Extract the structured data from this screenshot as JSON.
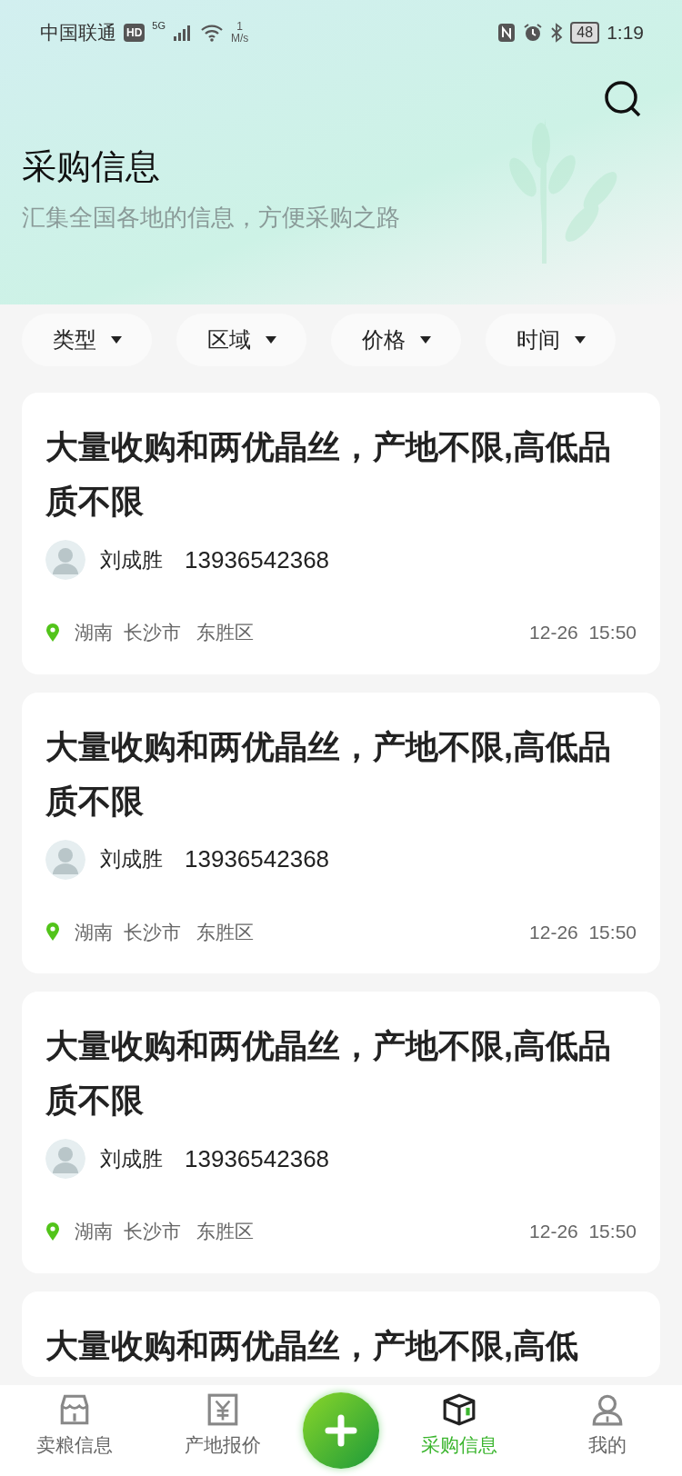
{
  "status_bar": {
    "carrier": "中国联通",
    "hd": "HD",
    "network": "5G",
    "speed_value": "1",
    "speed_unit": "M/s",
    "battery": "48",
    "time": "1:19"
  },
  "header": {
    "title": "采购信息",
    "subtitle": "汇集全国各地的信息，方便采购之路"
  },
  "filters": [
    "类型",
    "区域",
    "价格",
    "时间"
  ],
  "cards": [
    {
      "title": "大量收购和两优晶丝，产地不限,高低品质不限",
      "name": "刘成胜",
      "phone": "13936542368",
      "province": "湖南",
      "city": "长沙市",
      "district": "东胜区",
      "date": "12-26",
      "time": "15:50"
    },
    {
      "title": "大量收购和两优晶丝，产地不限,高低品质不限",
      "name": "刘成胜",
      "phone": "13936542368",
      "province": "湖南",
      "city": "长沙市",
      "district": "东胜区",
      "date": "12-26",
      "time": "15:50"
    },
    {
      "title": "大量收购和两优晶丝，产地不限,高低品质不限",
      "name": "刘成胜",
      "phone": "13936542368",
      "province": "湖南",
      "city": "长沙市",
      "district": "东胜区",
      "date": "12-26",
      "time": "15:50"
    },
    {
      "title": "大量收购和两优晶丝，产地不限,高低"
    }
  ],
  "nav": [
    {
      "kind": "store",
      "label": "卖粮信息",
      "selected": false
    },
    {
      "kind": "price",
      "label": "产地报价",
      "selected": false
    },
    {
      "kind": "add"
    },
    {
      "kind": "box",
      "label": "采购信息",
      "selected": true
    },
    {
      "kind": "user",
      "label": "我的",
      "selected": false
    }
  ]
}
